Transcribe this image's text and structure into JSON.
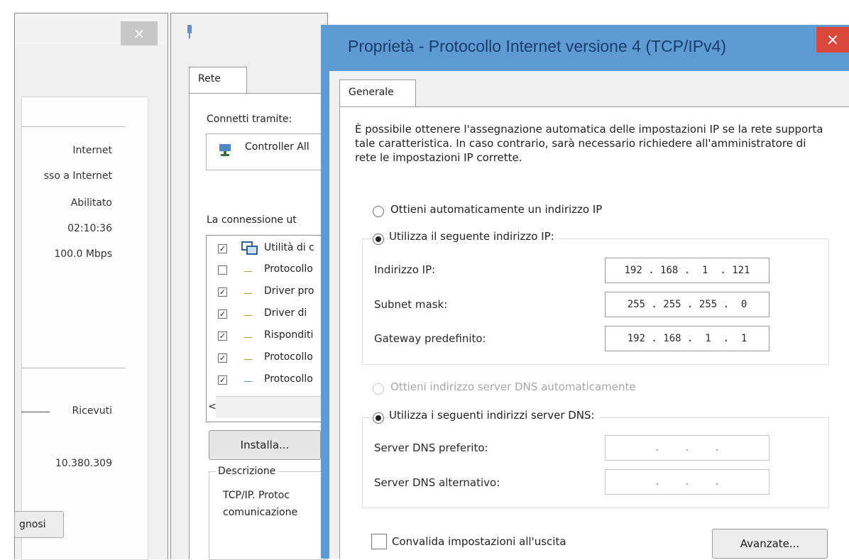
{
  "status_window": {
    "close_glyph": "×",
    "values": [
      "Internet",
      "sso a Internet",
      "Abilitato",
      "02:10:36",
      "100.0 Mbps"
    ],
    "received_label": "Ricevuti",
    "received_value": "10.380.309",
    "diagnose_button": "gnosi"
  },
  "properties_window": {
    "tab_label": "Rete",
    "connect_using_label": "Connetti tramite:",
    "adapter_name": "Controller All",
    "connection_uses_label": "La connessione ut",
    "items": [
      {
        "checked": true,
        "label": "Utilità di c"
      },
      {
        "checked": false,
        "label": "Protocollo"
      },
      {
        "checked": true,
        "label": "Driver pro"
      },
      {
        "checked": true,
        "label": "Driver di"
      },
      {
        "checked": true,
        "label": "Risponditi"
      },
      {
        "checked": true,
        "label": "Protocollo"
      },
      {
        "checked": true,
        "label": "Protocollo"
      }
    ],
    "scroll_left_glyph": "<",
    "install_button": "Installa...",
    "description_label": "Descrizione",
    "description_text_1": "TCP/IP. Protoc",
    "description_text_2": "comunicazione"
  },
  "dialog": {
    "title": "Proprietà - Protocollo Internet versione 4 (TCP/IPv4)",
    "close_glyph": "×",
    "tab_label": "Generale",
    "description": "È possibile ottenere l'assegnazione automatica delle impostazioni IP se la rete supporta tale caratteristica. In caso contrario, sarà necessario richiedere all'amministratore di rete le impostazioni IP corrette.",
    "ip_auto_label": "Ottieni automaticamente un indirizzo IP",
    "ip_manual_label": "Utilizza il seguente indirizzo IP:",
    "ip_address_label": "Indirizzo IP:",
    "ip_address_value": "192 . 168 .  1  . 121",
    "subnet_label": "Subnet mask:",
    "subnet_value": "255 . 255 . 255 .  0",
    "gateway_label": "Gateway predefinito:",
    "gateway_value": "192 . 168 .  1  .  1",
    "dns_auto_label": "Ottieni indirizzo server DNS automaticamente",
    "dns_manual_label": "Utilizza i seguenti indirizzi server DNS:",
    "dns_preferred_label": "Server DNS preferito:",
    "dns_preferred_value": " .    .    . ",
    "dns_alternate_label": "Server DNS alternativo:",
    "dns_alternate_value": " .    .    . ",
    "validate_label": "Convalida impostazioni all'uscita",
    "advanced_button": "Avanzate..."
  }
}
